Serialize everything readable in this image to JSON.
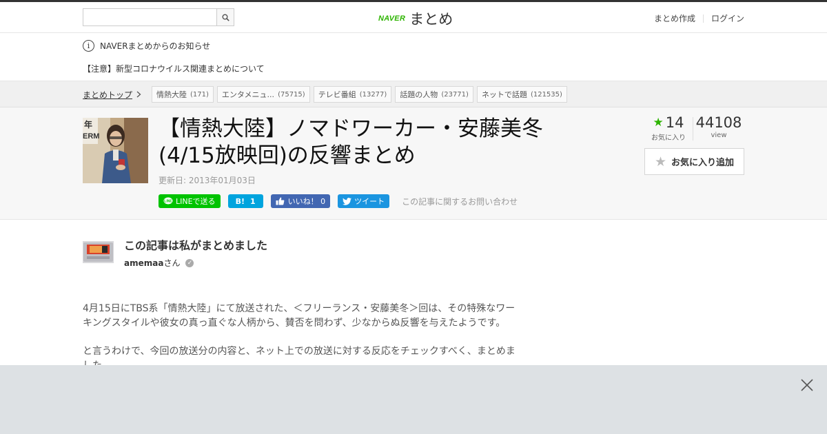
{
  "header": {
    "search": {
      "value": "",
      "placeholder": ""
    },
    "logo": {
      "brand": "NAVER",
      "service": "まとめ"
    },
    "nav": {
      "create": "まとめ作成",
      "login": "ログイン"
    }
  },
  "notice": {
    "title": "NAVERまとめからのお知らせ",
    "link": "【注意】新型コロナウイルス関連まとめについて"
  },
  "breadcrumb": {
    "top": "まとめトップ",
    "tags": [
      {
        "label": "情熱大陸",
        "count": "(171)"
      },
      {
        "label": "エンタメニュ...",
        "count": "(75715)"
      },
      {
        "label": "テレビ番組",
        "count": "(13277)"
      },
      {
        "label": "話題の人物",
        "count": "(23771)"
      },
      {
        "label": "ネットで話題",
        "count": "(121535)"
      }
    ]
  },
  "article": {
    "title": "【情熱大陸】ノマドワーカー・安藤美冬(4/15放映回)の反響まとめ",
    "updated": "更新日: 2013年01月03日",
    "share": {
      "line": "LINEで送る",
      "hatena": "1",
      "facebook": "いいね！ 0",
      "twitter": "ツイート"
    },
    "contact": "この記事に関するお問い合わせ",
    "favorites": "14",
    "favorites_label": "お気に入り",
    "views": "44108",
    "views_label": "view",
    "fav_button": "お気に入り追加"
  },
  "author": {
    "heading": "この記事は私がまとめました",
    "name": "amemaa",
    "suffix": "さん"
  },
  "body": {
    "p1": "4月15日にTBS系「情熱大陸」にて放送された、＜フリーランス・安藤美冬＞回は、その特殊なワーキングスタイルや彼女の真っ直ぐな人柄から、賛否を問わず、少なからぬ反響を与えたようです。",
    "p2": "と言うわけで、今回の放送分の内容と、ネット上での放送に対する反応をチェックすべく、まとめました。"
  },
  "colors": {
    "accent": "#2db400",
    "line": "#00c300",
    "hatena": "#00a4de",
    "facebook": "#4267b2",
    "twitter": "#1b95e0"
  },
  "icons": [
    "search-icon",
    "info-icon",
    "chevron-right-icon",
    "star-icon",
    "verified-icon",
    "close-icon"
  ]
}
